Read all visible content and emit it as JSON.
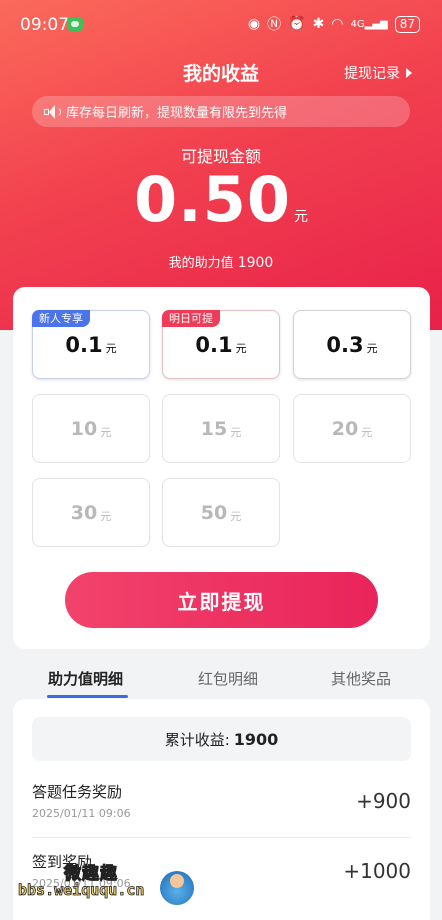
{
  "status_bar": {
    "time": "09:07",
    "battery": "87",
    "signal": "4G"
  },
  "header": {
    "title": "我的收益",
    "record_link": "提现记录"
  },
  "notice": {
    "text": "库存每日刷新，提现数量有限先到先得"
  },
  "balance": {
    "label": "可提现金额",
    "amount": "0.50",
    "unit": "元",
    "help_label": "我的助力值",
    "help_value": "1900"
  },
  "options": [
    {
      "value": "0.1",
      "unit": "元",
      "tag": "新人专享",
      "state": "active"
    },
    {
      "value": "0.1",
      "unit": "元",
      "tag": "明日可提",
      "state": "active"
    },
    {
      "value": "0.3",
      "unit": "元",
      "tag": "",
      "state": "active"
    },
    {
      "value": "10",
      "unit": "元",
      "tag": "",
      "state": "disabled"
    },
    {
      "value": "15",
      "unit": "元",
      "tag": "",
      "state": "disabled"
    },
    {
      "value": "20",
      "unit": "元",
      "tag": "",
      "state": "disabled"
    },
    {
      "value": "30",
      "unit": "元",
      "tag": "",
      "state": "disabled"
    },
    {
      "value": "50",
      "unit": "元",
      "tag": "",
      "state": "disabled"
    }
  ],
  "withdraw_button": "立即提现",
  "tabs": [
    {
      "label": "助力值明细",
      "active": true
    },
    {
      "label": "红包明细",
      "active": false
    },
    {
      "label": "其他奖品",
      "active": false
    }
  ],
  "detail": {
    "total_label": "累计收益:",
    "total_value": "1900",
    "records": [
      {
        "title": "答题任务奖励",
        "date": "2025/01/11 09:06",
        "amount": "+900"
      },
      {
        "title": "签到奖励",
        "date": "2025/01/11 09:06",
        "amount": "+1000"
      }
    ]
  },
  "watermark": {
    "text": "微趣趣",
    "url": "bbs.weiququ.cn"
  },
  "colors": {
    "primary_red": "#ef2f50",
    "tab_underline": "#3b6de0",
    "tag_blue": "#4a74e8",
    "tag_red": "#ef3b58"
  }
}
